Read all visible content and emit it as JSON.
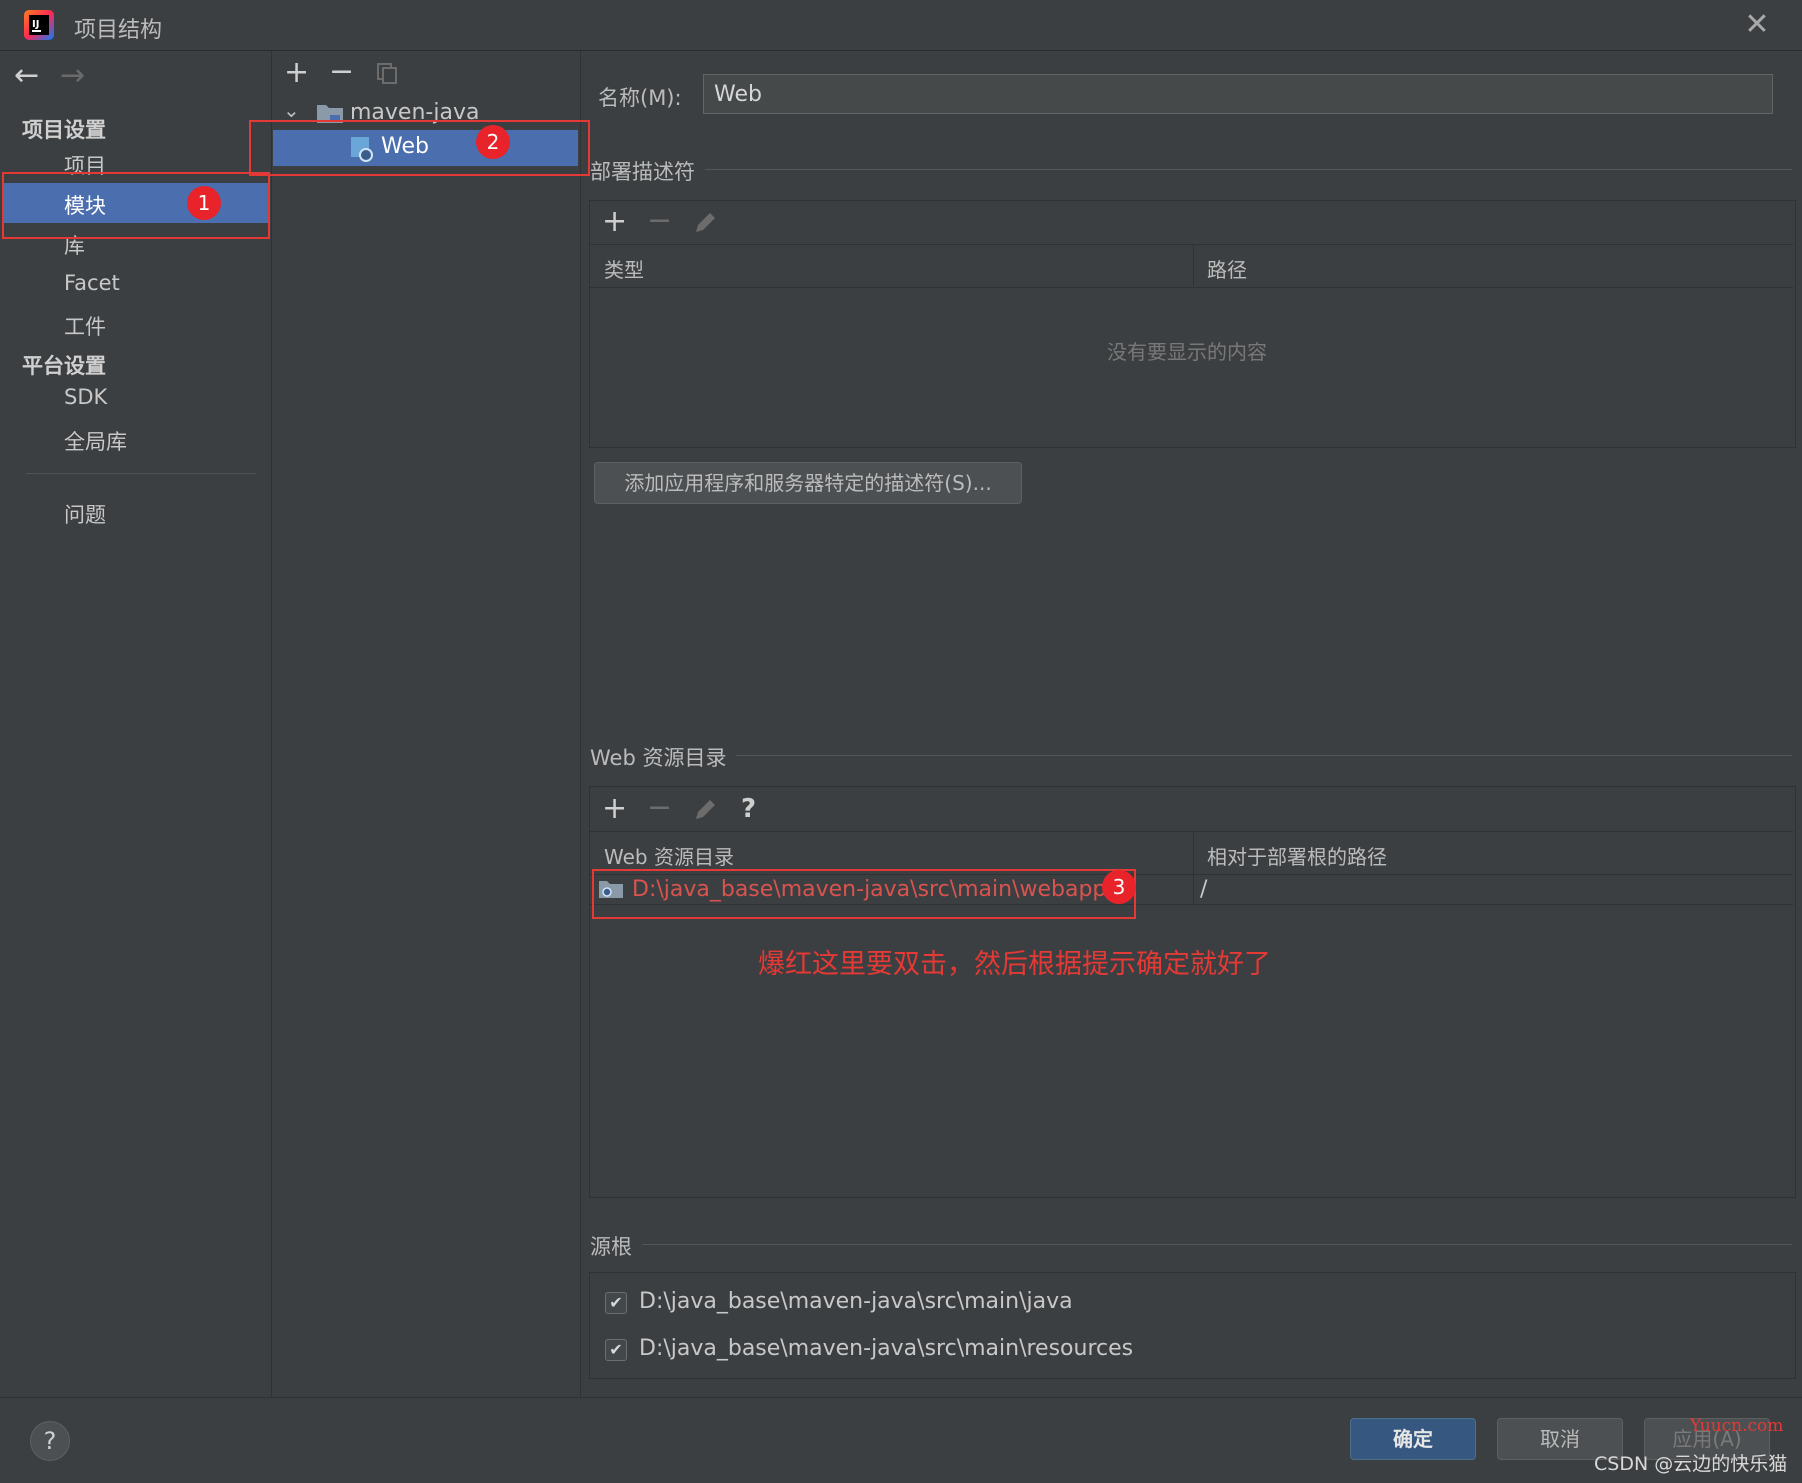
{
  "window": {
    "title": "项目结构"
  },
  "sidebar": {
    "project_settings_title": "项目设置",
    "platform_settings_title": "平台设置",
    "items": [
      {
        "label": "项目"
      },
      {
        "label": "模块",
        "selected": true
      },
      {
        "label": "库"
      },
      {
        "label": "Facet"
      },
      {
        "label": "工件"
      },
      {
        "label": "SDK"
      },
      {
        "label": "全局库"
      },
      {
        "label": "问题"
      }
    ]
  },
  "tree": {
    "root": "maven-java",
    "child": "Web"
  },
  "details": {
    "name_label": "名称(M):",
    "name_value": "Web",
    "deployment_descriptors": {
      "title": "部署描述符",
      "columns": [
        "类型",
        "路径"
      ],
      "empty_text": "没有要显示的内容",
      "add_button": "添加应用程序和服务器特定的描述符(S)..."
    },
    "web_resource_dirs": {
      "title": "Web 资源目录",
      "columns": [
        "Web 资源目录",
        "相对于部署根的路径"
      ],
      "rows": [
        {
          "dir": "D:\\java_base\\maven-java\\src\\main\\webapp",
          "relative": "/"
        }
      ],
      "help_glyph": "?"
    },
    "annotation": "爆红这里要双击，然后根据提示确定就好了",
    "source_roots": {
      "title": "源根",
      "items": [
        {
          "path": "D:\\java_base\\maven-java\\src\\main\\java",
          "checked": true
        },
        {
          "path": "D:\\java_base\\maven-java\\src\\main\\resources",
          "checked": true
        }
      ]
    }
  },
  "badges": [
    "1",
    "2",
    "3"
  ],
  "footer": {
    "ok": "确定",
    "cancel": "取消",
    "apply": "应用(A)",
    "watermark": "CSDN @云边的快乐猫",
    "site_mark": "Yuucn.com"
  },
  "colors": {
    "accent": "#4b6eaf",
    "annotation_red": "#e53935",
    "error_text": "#d9534f"
  }
}
